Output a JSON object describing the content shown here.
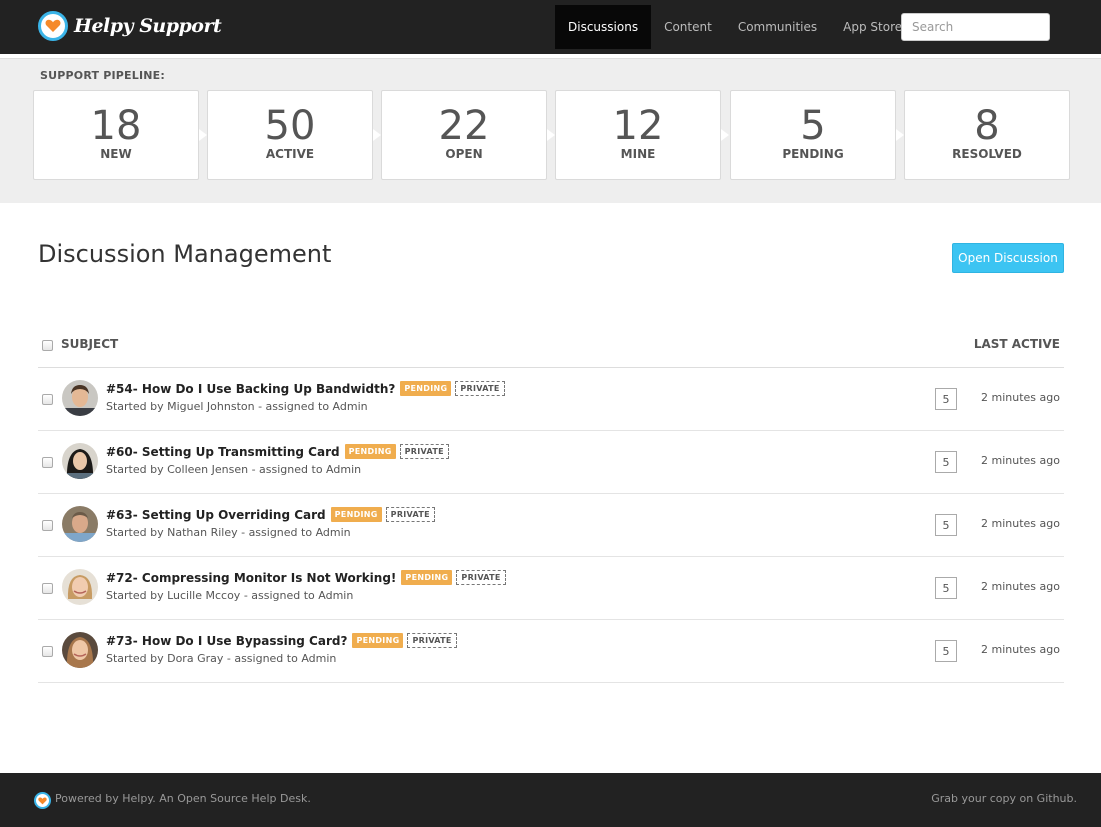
{
  "header": {
    "brand": "Helpy Support",
    "nav": [
      {
        "label": "Discussions",
        "active": true
      },
      {
        "label": "Content",
        "active": false
      },
      {
        "label": "Communities",
        "active": false
      },
      {
        "label": "App Store",
        "active": false
      }
    ],
    "search_placeholder": "Search"
  },
  "pipeline": {
    "label": "SUPPORT PIPELINE:",
    "stages": [
      {
        "count": "18",
        "name": "NEW"
      },
      {
        "count": "50",
        "name": "ACTIVE"
      },
      {
        "count": "22",
        "name": "OPEN"
      },
      {
        "count": "12",
        "name": "MINE"
      },
      {
        "count": "5",
        "name": "PENDING"
      },
      {
        "count": "8",
        "name": "RESOLVED"
      }
    ]
  },
  "main": {
    "title": "Discussion Management",
    "open_button": "Open Discussion",
    "columns": {
      "subject": "SUBJECT",
      "last_active": "LAST ACTIVE"
    },
    "rows": [
      {
        "subject": "#54- How Do I Use Backing Up Bandwidth?",
        "status": "PENDING",
        "visibility": "PRIVATE",
        "started_by": "Started by Miguel Johnston - assigned to Admin",
        "count": "5",
        "last_active": "2 minutes ago"
      },
      {
        "subject": "#60- Setting Up Transmitting Card",
        "status": "PENDING",
        "visibility": "PRIVATE",
        "started_by": "Started by Colleen Jensen - assigned to Admin",
        "count": "5",
        "last_active": "2 minutes ago"
      },
      {
        "subject": "#63- Setting Up Overriding Card",
        "status": "PENDING",
        "visibility": "PRIVATE",
        "started_by": "Started by Nathan Riley - assigned to Admin",
        "count": "5",
        "last_active": "2 minutes ago"
      },
      {
        "subject": "#72- Compressing Monitor Is Not Working!",
        "status": "PENDING",
        "visibility": "PRIVATE",
        "started_by": "Started by Lucille Mccoy - assigned to Admin",
        "count": "5",
        "last_active": "2 minutes ago"
      },
      {
        "subject": "#73- How Do I Use Bypassing Card?",
        "status": "PENDING",
        "visibility": "PRIVATE",
        "started_by": "Started by Dora Gray - assigned to Admin",
        "count": "5",
        "last_active": "2 minutes ago"
      }
    ]
  },
  "footer": {
    "left": "Powered by Helpy. An Open Source Help Desk.",
    "right": "Grab your copy on Github."
  },
  "colors": {
    "topbar": "#222222",
    "accent_button": "#3cc4f2",
    "pending_badge": "#f0ad4e",
    "logo_heart": "#f58a2a",
    "logo_ring": "#3ab4e8"
  }
}
